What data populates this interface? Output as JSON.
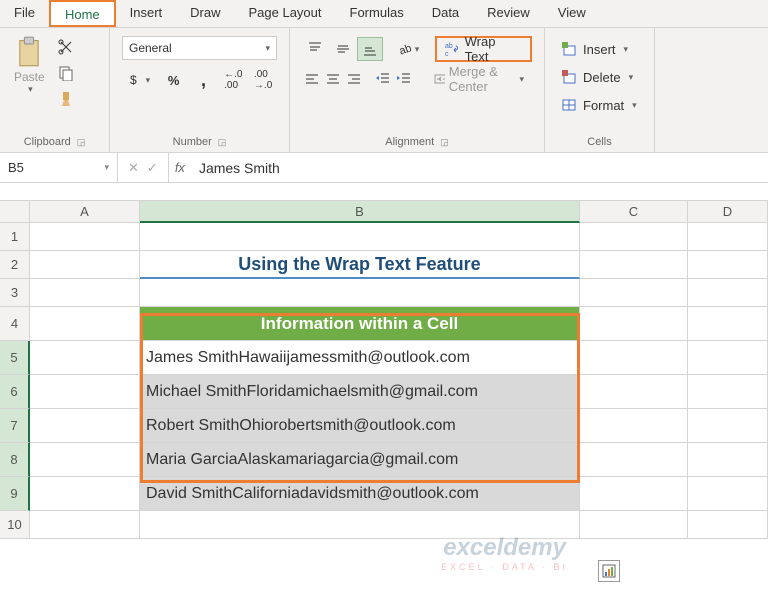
{
  "tabs": [
    "File",
    "Home",
    "Insert",
    "Draw",
    "Page Layout",
    "Formulas",
    "Data",
    "Review",
    "View"
  ],
  "active_tab": "Home",
  "ribbon": {
    "clipboard": {
      "label": "Clipboard",
      "paste": "Paste"
    },
    "number": {
      "label": "Number",
      "format": "General"
    },
    "alignment": {
      "label": "Alignment",
      "wrap_text": "Wrap Text",
      "merge_center": "Merge & Center"
    },
    "cells": {
      "label": "Cells",
      "insert": "Insert",
      "delete": "Delete",
      "format": "Format"
    }
  },
  "name_box": "B5",
  "formula_value": "James Smith",
  "columns": [
    "A",
    "B",
    "C",
    "D"
  ],
  "rows": [
    1,
    2,
    3,
    4,
    5,
    6,
    7,
    8,
    9,
    10
  ],
  "sheet": {
    "title": "Using the Wrap Text Feature",
    "header": "Information within a Cell",
    "data": [
      "James SmithHawaiijamessmith@outlook.com",
      "Michael SmithFloridamichaelsmith@gmail.com",
      "Robert SmithOhiorobertsmith@outlook.com",
      "Maria GarciaAlaskamariagarcia@gmail.com",
      "David SmithCaliforniadavidsmith@outlook.com"
    ]
  },
  "watermark": {
    "title": "exceldemy",
    "sub": "EXCEL · DATA · BI"
  }
}
